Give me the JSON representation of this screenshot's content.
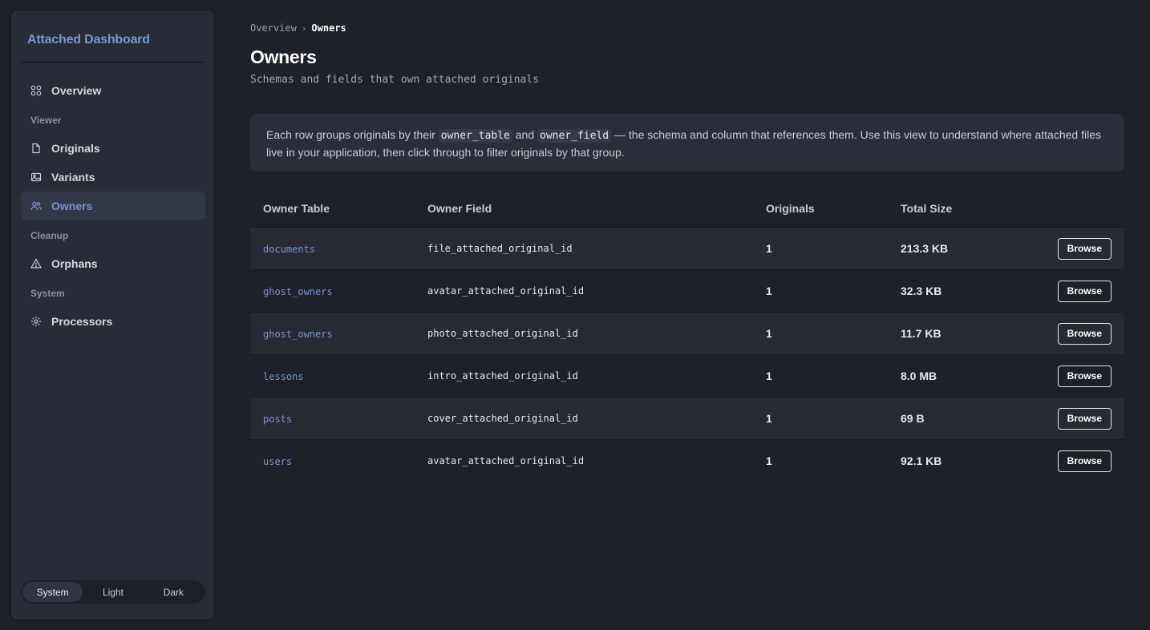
{
  "sidebar": {
    "brand": "Attached Dashboard",
    "items": [
      {
        "label": "Overview",
        "icon": "grid-icon"
      },
      {
        "section": "Viewer"
      },
      {
        "label": "Originals",
        "icon": "file-icon"
      },
      {
        "label": "Variants",
        "icon": "image-icon"
      },
      {
        "label": "Owners",
        "icon": "users-icon",
        "active": true
      },
      {
        "section": "Cleanup"
      },
      {
        "label": "Orphans",
        "icon": "warning-icon"
      },
      {
        "section": "System"
      },
      {
        "label": "Processors",
        "icon": "gear-icon"
      }
    ],
    "theme": {
      "options": [
        "System",
        "Light",
        "Dark"
      ],
      "selected": "System"
    }
  },
  "breadcrumb": {
    "parent": "Overview",
    "separator": "›",
    "current": "Owners"
  },
  "page": {
    "title": "Owners",
    "subtitle": "Schemas and fields that own attached originals"
  },
  "info": {
    "text1": "Each row groups originals by their ",
    "code1": "owner_table",
    "text2": " and ",
    "code2": "owner_field",
    "text3": " — the schema and column that references them. Use this view to understand where attached files live in your application, then click through to filter originals by that group."
  },
  "table": {
    "headers": [
      "Owner Table",
      "Owner Field",
      "Originals",
      "Total Size",
      ""
    ],
    "rows": [
      {
        "owner_table": "documents",
        "owner_field": "file_attached_original_id",
        "originals": "1",
        "total_size": "213.3 KB",
        "action": "Browse"
      },
      {
        "owner_table": "ghost_owners",
        "owner_field": "avatar_attached_original_id",
        "originals": "1",
        "total_size": "32.3 KB",
        "action": "Browse"
      },
      {
        "owner_table": "ghost_owners",
        "owner_field": "photo_attached_original_id",
        "originals": "1",
        "total_size": "11.7 KB",
        "action": "Browse"
      },
      {
        "owner_table": "lessons",
        "owner_field": "intro_attached_original_id",
        "originals": "1",
        "total_size": "8.0 MB",
        "action": "Browse"
      },
      {
        "owner_table": "posts",
        "owner_field": "cover_attached_original_id",
        "originals": "1",
        "total_size": "69 B",
        "action": "Browse"
      },
      {
        "owner_table": "users",
        "owner_field": "avatar_attached_original_id",
        "originals": "1",
        "total_size": "92.1 KB",
        "action": "Browse"
      }
    ]
  },
  "colors": {
    "accent": "#7b95d1",
    "background": "#1e2129",
    "sidebar": "#282c36"
  }
}
